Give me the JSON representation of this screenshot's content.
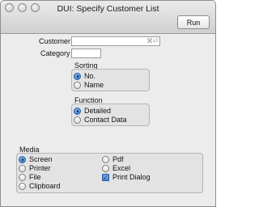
{
  "window": {
    "title": "DUI: Specify Customer List"
  },
  "toolbar": {
    "run_label": "Run"
  },
  "fields": {
    "customer": {
      "label": "Customer",
      "value": "",
      "shortcut_hint": "⌘⏎"
    },
    "category": {
      "label": "Category",
      "value": ""
    }
  },
  "sorting": {
    "label": "Sorting",
    "options": [
      {
        "label": "No.",
        "selected": true
      },
      {
        "label": "Name",
        "selected": false
      }
    ]
  },
  "function": {
    "label": "Function",
    "options": [
      {
        "label": "Detailed",
        "selected": true
      },
      {
        "label": "Contact Data",
        "selected": false
      }
    ]
  },
  "media": {
    "label": "Media",
    "options": [
      {
        "label": "Screen",
        "selected": true
      },
      {
        "label": "Printer",
        "selected": false
      },
      {
        "label": "File",
        "selected": false
      },
      {
        "label": "Clipboard",
        "selected": false
      },
      {
        "label": "Pdf",
        "selected": false
      },
      {
        "label": "Excel",
        "selected": false
      }
    ],
    "print_dialog": {
      "label": "Print Dialog",
      "checked": true
    }
  }
}
